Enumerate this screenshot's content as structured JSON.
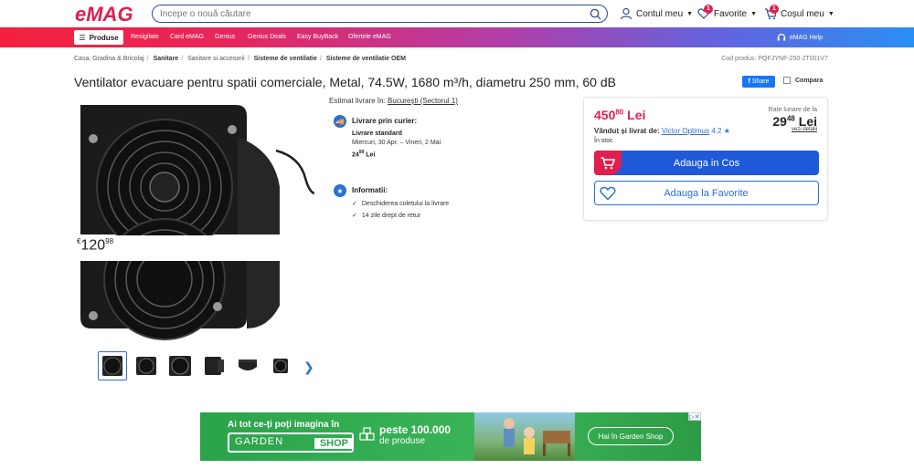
{
  "header": {
    "logo": "eMAG",
    "search_placeholder": "Începe o nouă căutare",
    "account_label": "Contul meu",
    "favorites_label": "Favorite",
    "favorites_count": "1",
    "cart_label": "Coșul meu",
    "cart_count": "1"
  },
  "nav": {
    "produse": "Produse",
    "links": [
      "Resigilate",
      "Card eMAG",
      "Genius",
      "Genius Deals",
      "Easy BuyBack",
      "Ofertele eMAG"
    ],
    "help": "eMAG Help"
  },
  "breadcrumb": {
    "items": [
      "Casa, Gradina & Bricolaj",
      "Sanitare",
      "Sanitare si accesorii",
      "Sisteme de ventilatie",
      "Sisteme de ventilatie OEM"
    ],
    "product_code": "Cod produs: PQFJYNF-250-2T001V7"
  },
  "product": {
    "title": "Ventilator evacuare pentru spatii comerciale, Metal, 74.5W, 1680 m³/h, diametru 250 mm, 60 dB",
    "share": "Share",
    "compare": "Compara",
    "overlay_price_currency": "€",
    "overlay_price_int": "120",
    "overlay_price_dec": "98"
  },
  "delivery": {
    "estimate_label": "Estimat livrare în:",
    "estimate_location": "București (Sectorul 1)",
    "courier_title": "Livrare prin curier:",
    "standard_title": "Livrare standard",
    "standard_dates": "Miercuri, 30 Apr. – Vineri, 2 Mai",
    "standard_price_int": "24",
    "standard_price_dec": "99",
    "standard_price_cur": "Lei",
    "info_title": "Informatii:",
    "info_items": [
      "Deschiderea coletului la livrare",
      "14 zile drept de retur"
    ]
  },
  "buybox": {
    "price_int": "450",
    "price_dec": "80",
    "price_cur": "Lei",
    "rate_label": "Rate lunare de la",
    "rate_int": "29",
    "rate_dec": "48",
    "rate_cur": "Lei",
    "rate_details": "vezi detalii",
    "seller_label": "Vândut și livrat de:",
    "seller_name": "Victor Optimus",
    "seller_rating": "4.2",
    "stock": "În stoc",
    "add_to_cart": "Adauga in Cos",
    "add_to_fav": "Adauga la Favorite"
  },
  "banner": {
    "line1": "Ai tot ce-ți poți imagina în",
    "garden": "GARDEN",
    "shop": "SHOP",
    "products_count": "peste 100.000",
    "products_label": "de produse",
    "cta": "Hai în Garden Shop"
  },
  "colors": {
    "brand_red": "#e21e4d",
    "brand_blue": "#1e5ad8",
    "link_blue": "#2b6fd6"
  }
}
